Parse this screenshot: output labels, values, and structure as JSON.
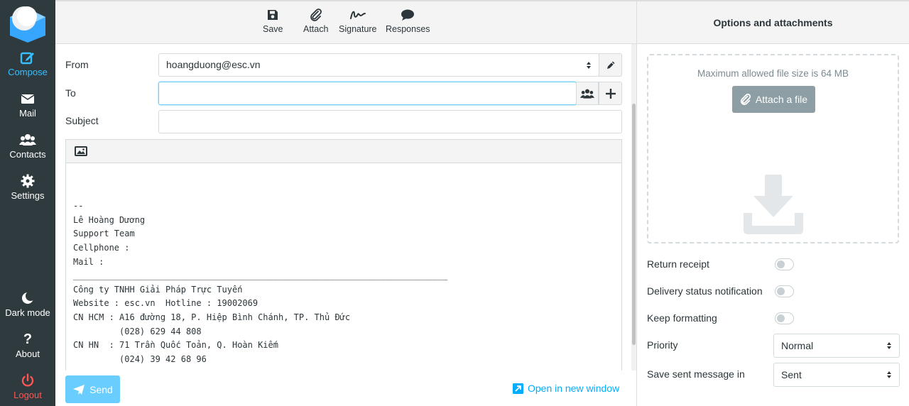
{
  "sidebar": {
    "items": [
      {
        "label": "Compose",
        "icon": "compose-icon"
      },
      {
        "label": "Mail",
        "icon": "envelope-icon"
      },
      {
        "label": "Contacts",
        "icon": "users-icon"
      },
      {
        "label": "Settings",
        "icon": "gear-icon"
      }
    ],
    "bottom": [
      {
        "label": "Dark mode",
        "icon": "moon-icon"
      },
      {
        "label": "About",
        "icon": "question-icon"
      },
      {
        "label": "Logout",
        "icon": "power-icon"
      }
    ]
  },
  "toolbar": {
    "save": "Save",
    "attach": "Attach",
    "signature": "Signature",
    "responses": "Responses"
  },
  "form": {
    "from_label": "From",
    "from_value": "hoangduong@esc.vn",
    "to_label": "To",
    "to_value": "",
    "subject_label": "Subject",
    "subject_value": ""
  },
  "editor": {
    "lines": [
      "",
      "",
      "--",
      "Lê Hoàng Dương",
      "Support Team",
      "Cellphone :",
      "Mail :",
      "_________________________________________________________________________",
      "Công ty TNHH Giải Pháp Trực Tuyến",
      "Website : esc.vn  Hotline : 19002069",
      "CN HCM : A16 đường 18, P. Hiệp Bình Chánh, TP. Thủ Đức",
      "         (028) 629 44 808",
      "CN HN  : 71 Trần Quốc Toản, Q. Hoàn Kiếm",
      "         (024) 39 42 68 96"
    ]
  },
  "footer": {
    "send": "Send",
    "open_new_window": "Open in new window"
  },
  "panel": {
    "title": "Options and attachments",
    "max_size": "Maximum allowed file size is 64 MB",
    "attach_file": "Attach a file",
    "return_receipt": "Return receipt",
    "delivery_status": "Delivery status notification",
    "keep_formatting": "Keep formatting",
    "priority_label": "Priority",
    "priority_value": "Normal",
    "save_sent_label": "Save sent message in",
    "save_sent_value": "Sent"
  },
  "colors": {
    "sidebar_bg": "#2f3a3f",
    "accent": "#37beff",
    "logout": "#ff5552"
  }
}
